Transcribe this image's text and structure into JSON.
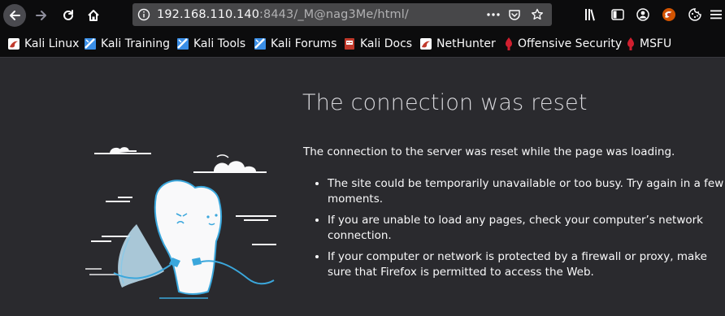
{
  "browser": {
    "url": {
      "host": "192.168.110.140",
      "rest": ":8443/_M@nag3Me/html/"
    }
  },
  "bookmarks": [
    {
      "label": "Kali Linux",
      "icon": "kali-dragon-icon"
    },
    {
      "label": "Kali Training",
      "icon": "kali-icon"
    },
    {
      "label": "Kali Tools",
      "icon": "kali-icon"
    },
    {
      "label": "Kali Forums",
      "icon": "kali-icon"
    },
    {
      "label": "Kali Docs",
      "icon": "kali-docs-icon"
    },
    {
      "label": "NetHunter",
      "icon": "kali-dragon-icon"
    },
    {
      "label": "Offensive Security",
      "icon": "offsec-icon"
    },
    {
      "label": "MSFU",
      "icon": "offsec-icon"
    }
  ],
  "error": {
    "title": "The connection was reset",
    "description": "The connection to the server was reset while the page was loading.",
    "bullets": [
      "The site could be temporarily unavailable or too busy. Try again in a few moments.",
      "If you are unable to load any pages, check your computer’s network connection.",
      "If your computer or network is protected by a firewall or proxy, make sure that Firefox is permitted to access the Web."
    ]
  }
}
